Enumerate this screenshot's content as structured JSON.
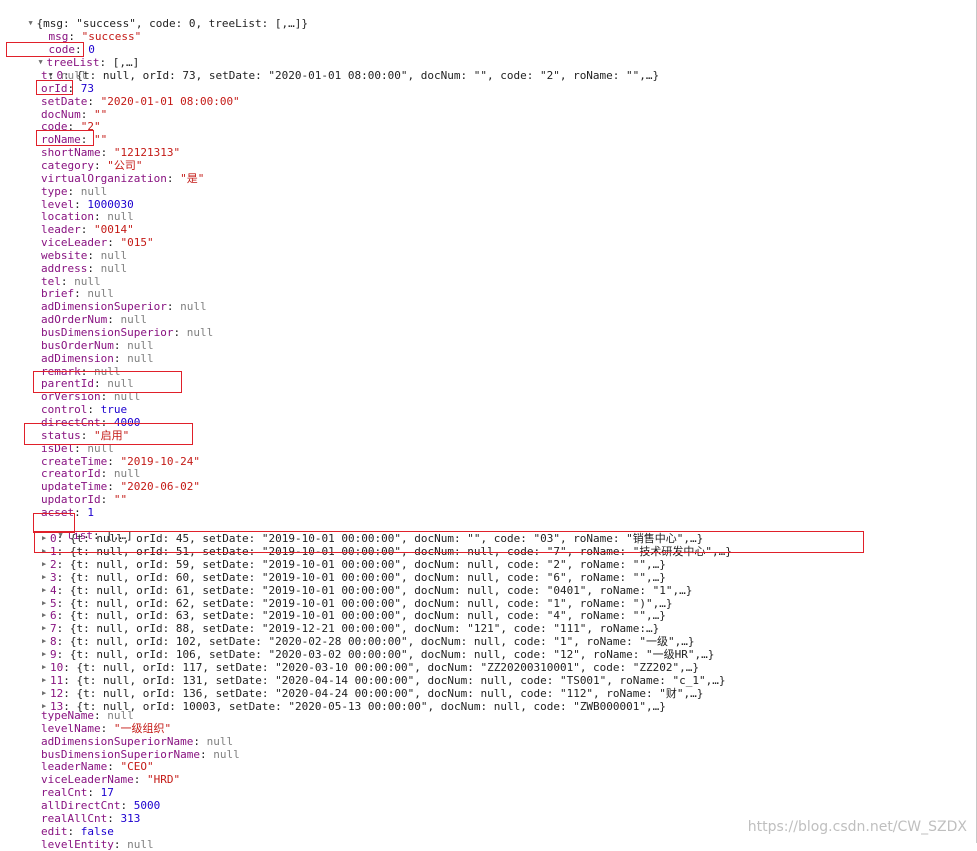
{
  "root_line": "{msg: \"success\", code: 0, treeList: [,…]}",
  "msg_key": "msg",
  "msg_val": "\"success\"",
  "code_key": "code",
  "code_val": "0",
  "treeList_key": "treeList",
  "treeList_preview": "[,…]",
  "item0_index": "0",
  "item0_preview": "{t: null, orId: 73, setDate: \"2020-01-01 08:00:00\", docNum: \"\", code: \"2\", roName: \"\",…}",
  "fields": [
    {
      "key": "t",
      "val": "null",
      "type": "null"
    },
    {
      "key": "orId",
      "val": "73",
      "type": "num"
    },
    {
      "key": "setDate",
      "val": "\"2020-01-01 08:00:00\"",
      "type": "str"
    },
    {
      "key": "docNum",
      "val": "\"\"",
      "type": "str"
    },
    {
      "key": "code",
      "val": "\"2\"",
      "type": "str"
    },
    {
      "key": "roName",
      "val": "\"\"",
      "type": "str"
    },
    {
      "key": "shortName",
      "val": "\"12121313\"",
      "type": "str"
    },
    {
      "key": "category",
      "val": "\"公司\"",
      "type": "str"
    },
    {
      "key": "virtualOrganization",
      "val": "\"是\"",
      "type": "str"
    },
    {
      "key": "type",
      "val": "null",
      "type": "null"
    },
    {
      "key": "level",
      "val": "1000030",
      "type": "num"
    },
    {
      "key": "location",
      "val": "null",
      "type": "null"
    },
    {
      "key": "leader",
      "val": "\"0014\"",
      "type": "str"
    },
    {
      "key": "viceLeader",
      "val": "\"015\"",
      "type": "str"
    },
    {
      "key": "website",
      "val": "null",
      "type": "null"
    },
    {
      "key": "address",
      "val": "null",
      "type": "null"
    },
    {
      "key": "tel",
      "val": "null",
      "type": "null"
    },
    {
      "key": "brief",
      "val": "null",
      "type": "null"
    },
    {
      "key": "adDimensionSuperior",
      "val": "null",
      "type": "null"
    },
    {
      "key": "adOrderNum",
      "val": "null",
      "type": "null"
    },
    {
      "key": "busDimensionSuperior",
      "val": "null",
      "type": "null"
    },
    {
      "key": "busOrderNum",
      "val": "null",
      "type": "null"
    },
    {
      "key": "adDimension",
      "val": "null",
      "type": "null"
    },
    {
      "key": "remark",
      "val": "null",
      "type": "null"
    },
    {
      "key": "parentId",
      "val": "null",
      "type": "null"
    },
    {
      "key": "orVersion",
      "val": "null",
      "type": "null"
    },
    {
      "key": "control",
      "val": "true",
      "type": "bool"
    },
    {
      "key": "directCnt",
      "val": "4000",
      "type": "num"
    },
    {
      "key": "status",
      "val": "\"启用\"",
      "type": "str"
    },
    {
      "key": "isDel",
      "val": "null",
      "type": "null"
    },
    {
      "key": "createTime",
      "val": "\"2019-10-24\"",
      "type": "str"
    },
    {
      "key": "creatorId",
      "val": "null",
      "type": "null"
    },
    {
      "key": "updateTime",
      "val": "\"2020-06-02\"",
      "type": "str"
    },
    {
      "key": "updatorId",
      "val": "\"\"",
      "type": "str"
    },
    {
      "key": "acset",
      "val": "1",
      "type": "num"
    }
  ],
  "list_key": "list",
  "list_preview": "[,…]",
  "list_items": [
    {
      "index": "0",
      "text": "{t: null, orId: 45, setDate: \"2019-10-01 00:00:00\", docNum: \"\", code: \"03\", roName: \"销售中心\",…}"
    },
    {
      "index": "1",
      "text": "{t: null, orId: 51, setDate: \"2019-10-01 00:00:00\", docNum: null, code: \"7\", roName: \"技术研发中心\",…}"
    },
    {
      "index": "2",
      "text": "{t: null, orId: 59, setDate: \"2019-10-01 00:00:00\", docNum: null, code: \"2\", roName: \"\",…}"
    },
    {
      "index": "3",
      "text": "{t: null, orId: 60, setDate: \"2019-10-01 00:00:00\", docNum: null, code: \"6\", roName: \"\",…}"
    },
    {
      "index": "4",
      "text": "{t: null, orId: 61, setDate: \"2019-10-01 00:00:00\", docNum: null, code: \"0401\", roName: \"1\",…}"
    },
    {
      "index": "5",
      "text": "{t: null, orId: 62, setDate: \"2019-10-01 00:00:00\", docNum: null, code: \"1\", roName: \")\",…}"
    },
    {
      "index": "6",
      "text": "{t: null, orId: 63, setDate: \"2019-10-01 00:00:00\", docNum: null, code: \"4\", roName: \"\",…}"
    },
    {
      "index": "7",
      "text": "{t: null, orId: 88, setDate: \"2019-12-21 00:00:00\", docNum: \"121\", code: \"111\", roName:…}"
    },
    {
      "index": "8",
      "text": "{t: null, orId: 102, setDate: \"2020-02-28 00:00:00\", docNum: null, code: \"1\", roName: \"一级\",…}"
    },
    {
      "index": "9",
      "text": "{t: null, orId: 106, setDate: \"2020-03-02 00:00:00\", docNum: null, code: \"12\", roName: \"一级HR\",…}"
    },
    {
      "index": "10",
      "text": "{t: null, orId: 117, setDate: \"2020-03-10 00:00:00\", docNum: \"ZZ20200310001\", code: \"ZZ202\",…}"
    },
    {
      "index": "11",
      "text": "{t: null, orId: 131, setDate: \"2020-04-14 00:00:00\", docNum: null, code: \"TS001\", roName: \"c_1\",…}"
    },
    {
      "index": "12",
      "text": "{t: null, orId: 136, setDate: \"2020-04-24 00:00:00\", docNum: null, code: \"112\", roName: \"财\",…}"
    },
    {
      "index": "13",
      "text": "{t: null, orId: 10003, setDate: \"2020-05-13 00:00:00\", docNum: null, code: \"ZWB000001\",…}"
    }
  ],
  "after_fields": [
    {
      "key": "typeName",
      "val": "null",
      "type": "null"
    },
    {
      "key": "levelName",
      "val": "\"一级组织\"",
      "type": "str"
    },
    {
      "key": "adDimensionSuperiorName",
      "val": "null",
      "type": "null"
    },
    {
      "key": "busDimensionSuperiorName",
      "val": "null",
      "type": "null"
    },
    {
      "key": "leaderName",
      "val": "\"CEO\"",
      "type": "str"
    },
    {
      "key": "viceLeaderName",
      "val": "\"HRD\"",
      "type": "str"
    },
    {
      "key": "realCnt",
      "val": "17",
      "type": "num"
    },
    {
      "key": "allDirectCnt",
      "val": "5000",
      "type": "num"
    },
    {
      "key": "realAllCnt",
      "val": "313",
      "type": "num"
    },
    {
      "key": "edit",
      "val": "false",
      "type": "bool"
    },
    {
      "key": "levelEntity",
      "val": "null",
      "type": "null"
    }
  ],
  "watermark": "https://blog.csdn.net/CW_SZDX",
  "colors": {
    "key": "#881280",
    "string": "#c41a16",
    "number": "#1c00cf",
    "null": "#808080",
    "highlight": "#e0202a"
  }
}
